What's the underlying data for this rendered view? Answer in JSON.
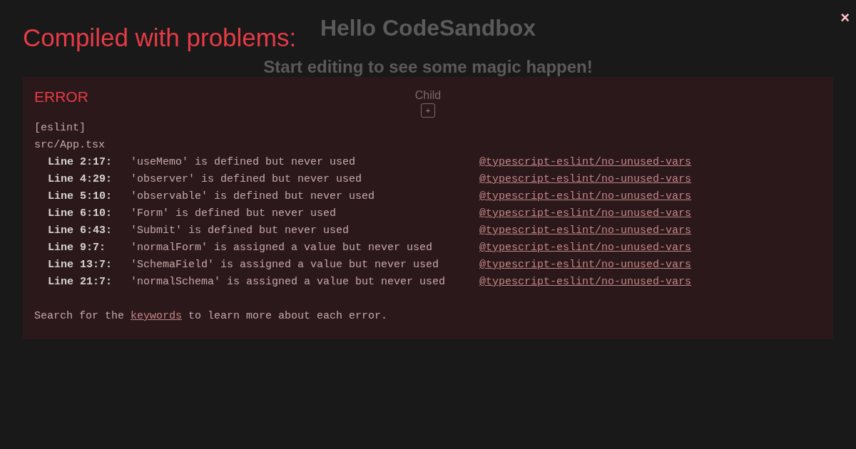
{
  "page": {
    "heading": "Hello CodeSandbox",
    "subheading": "Start editing to see some magic happen!",
    "child_label": "Child",
    "add_button": "+"
  },
  "overlay": {
    "title": "Compiled with problems:",
    "close": "×",
    "error": {
      "label": "ERROR",
      "source": "[eslint]",
      "file": "src/App.tsx",
      "problems": [
        {
          "location": "Line 2:17:",
          "message": "'useMemo' is defined but never used",
          "rule": "@typescript-eslint/no-unused-vars"
        },
        {
          "location": "Line 4:29:",
          "message": "'observer' is defined but never used",
          "rule": "@typescript-eslint/no-unused-vars"
        },
        {
          "location": "Line 5:10:",
          "message": "'observable' is defined but never used",
          "rule": "@typescript-eslint/no-unused-vars"
        },
        {
          "location": "Line 6:10:",
          "message": "'Form' is defined but never used",
          "rule": "@typescript-eslint/no-unused-vars"
        },
        {
          "location": "Line 6:43:",
          "message": "'Submit' is defined but never used",
          "rule": "@typescript-eslint/no-unused-vars"
        },
        {
          "location": "Line 9:7:",
          "message": "'normalForm' is assigned a value but never used",
          "rule": "@typescript-eslint/no-unused-vars"
        },
        {
          "location": "Line 13:7:",
          "message": "'SchemaField' is assigned a value but never used",
          "rule": "@typescript-eslint/no-unused-vars"
        },
        {
          "location": "Line 21:7:",
          "message": "'normalSchema' is assigned a value but never used",
          "rule": "@typescript-eslint/no-unused-vars"
        }
      ],
      "hint": {
        "before": "Search for the ",
        "link": "keywords",
        "after": " to learn more about each error."
      }
    }
  }
}
